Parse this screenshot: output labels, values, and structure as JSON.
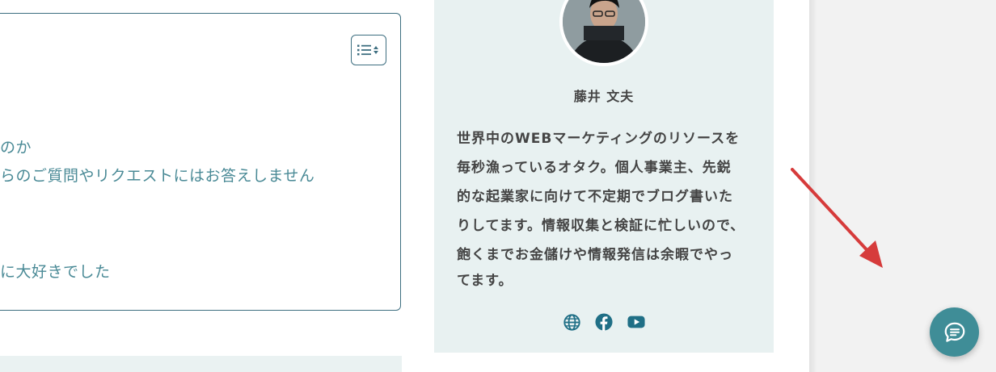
{
  "toc": {
    "items": [
      "のか",
      "らのご質問やリクエストにはお答えしません",
      "に大好きでした"
    ]
  },
  "profile": {
    "name": "藤井 文夫",
    "bio_lines": [
      "世界中のWEBマーケティングのリソースを",
      "毎秒漁っているオタク。個人事業主、先鋭",
      "的な起業家に向けて不定期でブログ書いた",
      "りしてます。情報収集と検証に忙しいので、",
      "飽くまでお金儲けや情報発信は余暇でやっ",
      "てます。"
    ],
    "social_icons": [
      "globe-icon",
      "facebook-icon",
      "youtube-icon"
    ]
  },
  "colors": {
    "accent": "#3f8d97",
    "icon": "#1f6f86",
    "arrow": "#d63b3b",
    "card_bg": "#e8f1f1"
  }
}
